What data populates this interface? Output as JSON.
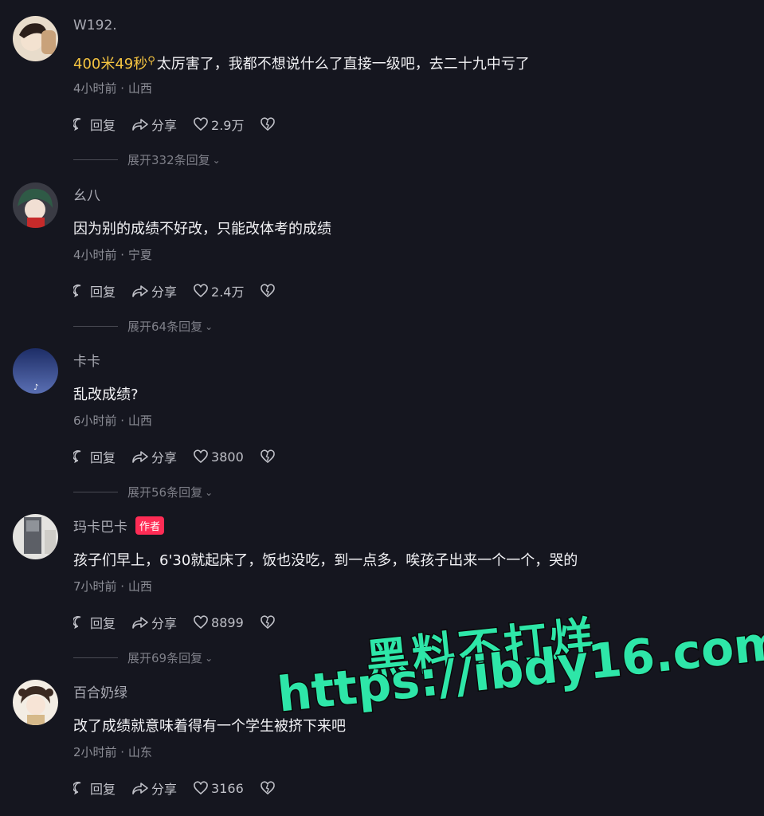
{
  "comments": [
    {
      "username": "W192.",
      "highlight": "400米49秒",
      "text": "太厉害了，我都不想说什么了直接一级吧，去二十九中亏了",
      "meta": "4小时前 · 山西",
      "reply_label": "回复",
      "share_label": "分享",
      "likes": "2.9万",
      "replies": "展开332条回复",
      "author_badge": ""
    },
    {
      "username": "幺八",
      "highlight": "",
      "text": "因为别的成绩不好改，只能改体考的成绩",
      "meta": "4小时前 · 宁夏",
      "reply_label": "回复",
      "share_label": "分享",
      "likes": "2.4万",
      "replies": "展开64条回复",
      "author_badge": ""
    },
    {
      "username": "卡卡",
      "highlight": "",
      "text": "乱改成绩?",
      "meta": "6小时前 · 山西",
      "reply_label": "回复",
      "share_label": "分享",
      "likes": "3800",
      "replies": "展开56条回复",
      "author_badge": ""
    },
    {
      "username": "玛卡巴卡",
      "highlight": "",
      "text": "孩子们早上，6'30就起床了，饭也没吃，到一点多，唉孩子出来一个一个，哭的",
      "meta": "7小时前 · 山西",
      "reply_label": "回复",
      "share_label": "分享",
      "likes": "8899",
      "replies": "展开69条回复",
      "author_badge": "作者"
    },
    {
      "username": "百合奶绿",
      "highlight": "",
      "text": "改了成绩就意味着得有一个学生被挤下来吧",
      "meta": "2小时前 · 山东",
      "reply_label": "回复",
      "share_label": "分享",
      "likes": "3166",
      "replies": "",
      "author_badge": ""
    }
  ],
  "icons": {
    "reply": "comment-bubble-icon",
    "share": "share-arrow-icon",
    "like": "heart-icon",
    "dislike": "broken-heart-icon",
    "search": "search-icon"
  },
  "colors": {
    "background": "#15161f",
    "highlight": "#f5c441",
    "author_badge": "#fe2c55",
    "watermark": "#2ee6a8"
  },
  "watermark": {
    "line1": "黑料不打烊",
    "line2": "https://ibdy16.com"
  }
}
